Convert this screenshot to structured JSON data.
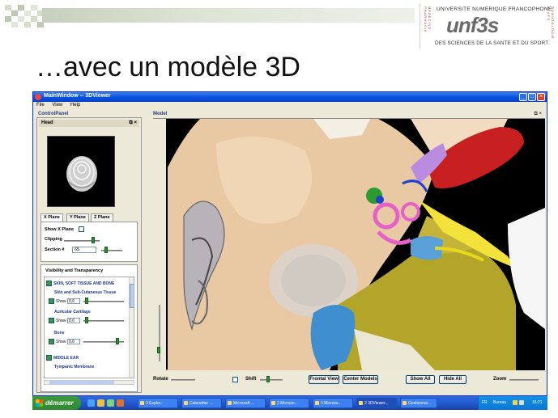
{
  "slide": {
    "title": "…avec un modèle 3D"
  },
  "logo": {
    "university": "UNIVERSITE NUMERIQUE FRANCOPHONE",
    "brand": "unf3s",
    "tagline": "DES SCIENCES DE LA SANTE ET DU SPORT",
    "side_left": "MEDECINE · PHARMACIE",
    "side_right": "ODONTOLOGIE · STAPS"
  },
  "window": {
    "title": "MainWindow -- 3DViewer",
    "menu": [
      "File",
      "View",
      "Help"
    ],
    "control_panel_title": "ControlPanel",
    "model_title": "Model"
  },
  "head_panel": {
    "title": "Head"
  },
  "plane_tabs": {
    "tabs": [
      "X Plane",
      "Y Plane",
      "Z Plane"
    ],
    "active": 0,
    "show_label": "Show X Plane",
    "clipping_label": "Clipping",
    "section_label": "Section #",
    "section_value": "65"
  },
  "visibility": {
    "title": "Visibility and Transparency",
    "group1": "SKIN, SOFT TISSUE AND BONE",
    "items": [
      {
        "name": "Skin and Sub-Cutaneous Tissue",
        "show": "Show",
        "value": "0,0",
        "level": 0.05
      },
      {
        "name": "Auricular Cartilage",
        "show": "Show",
        "value": "0,0",
        "level": 0.05
      },
      {
        "name": "Bone",
        "show": "Show",
        "value": "0,0",
        "level": 0.78
      }
    ],
    "group2": "MIDDLE EAR",
    "group2_sub": "Tympanic Membrane"
  },
  "toolbar": {
    "rotate": "Rotate",
    "shift": "Shift",
    "frontal_view": "Frontal View",
    "center_models": "Center Models",
    "show_all": "Show All",
    "hide_all": "Hide All",
    "zoom": "Zoom"
  },
  "taskbar": {
    "start": "démarrer",
    "tasks": [
      "3 Explor...",
      "Calendrier ...",
      "Microsoft ...",
      "2 Microso...",
      "3 Microso...",
      "2 3DViewer...",
      "Gestionnai..."
    ],
    "active_index": 5,
    "lang": "FR",
    "tray_label": "Bureau",
    "clock": "16:21"
  },
  "colors": {
    "xp_blue": "#0a54e0",
    "start_green": "#3c9a3c",
    "skin": "#e8c9a4",
    "bone_yellow": "#b3a42a",
    "vessel_red": "#c82020",
    "cochlea_pink": "#e560c8",
    "nerve_yellow": "#f2e23a",
    "membrane_blue": "#3f8fd0"
  }
}
